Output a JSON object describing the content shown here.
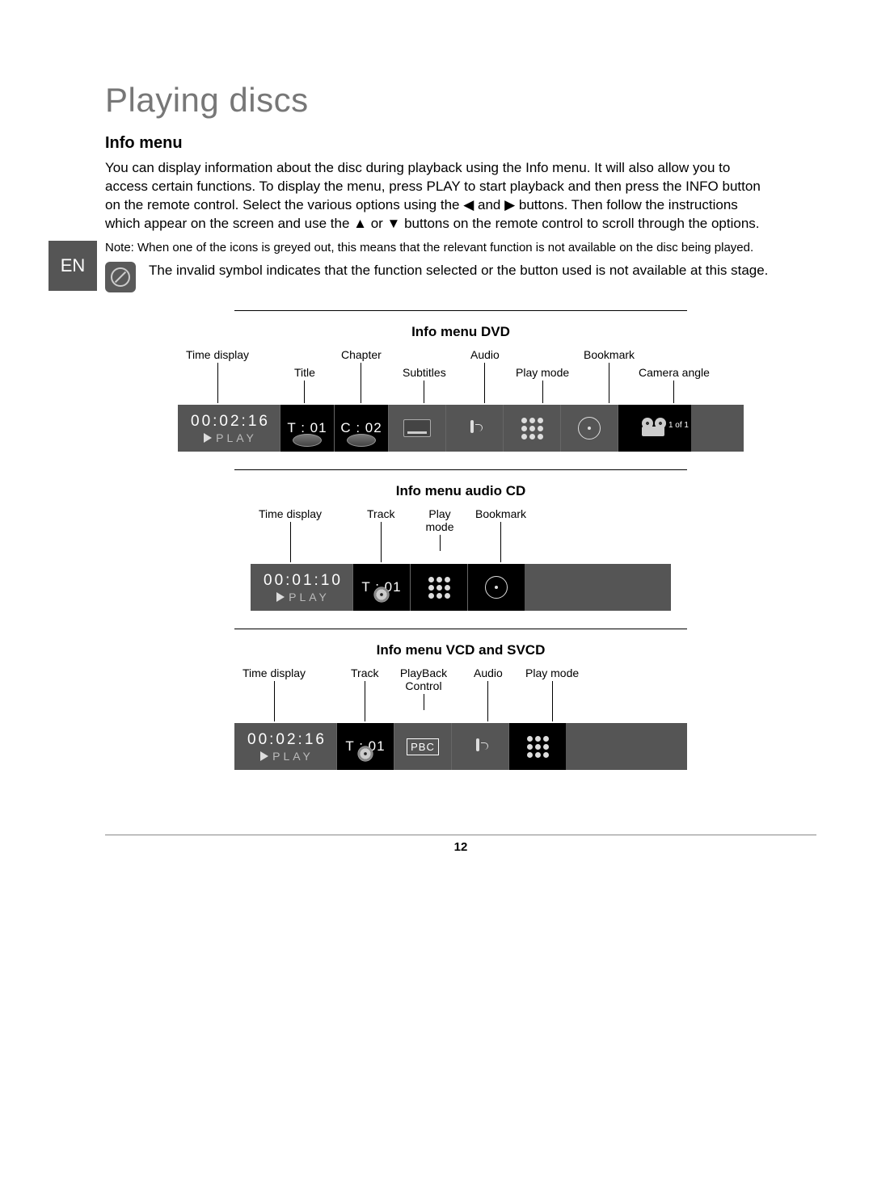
{
  "lang_tab": "EN",
  "page_title": "Playing discs",
  "section_heading": "Info menu",
  "paragraph": "You can display information about the disc during playback using the Info menu. It will also allow you to access certain functions. To display the menu, press PLAY to start playback and then press the INFO button on the remote control. Select the various options using the ◀ and ▶ buttons. Then follow the instructions which appear on the screen and use the ▲ or ▼ buttons on the remote control to scroll through the options.",
  "note": "Note: When one of the icons is greyed out, this means that the relevant function is not available on the disc being played.",
  "invalid_note": "The invalid symbol indicates that the function selected or the button used is not available at this stage.",
  "page_number": "12",
  "dvd": {
    "title": "Info menu DVD",
    "labels": {
      "time_display": "Time display",
      "title": "Title",
      "chapter": "Chapter",
      "subtitles": "Subtitles",
      "audio": "Audio",
      "play_mode": "Play mode",
      "bookmark": "Bookmark",
      "camera_angle": "Camera angle"
    },
    "bar": {
      "time": "00:02:16",
      "play": "PLAY",
      "title_val": "T : 01",
      "chapter_val": "C : 02",
      "angle_text": "1 of 1"
    }
  },
  "cd": {
    "title": "Info menu audio CD",
    "labels": {
      "time_display": "Time display",
      "track": "Track",
      "play_mode": "Play mode",
      "bookmark": "Bookmark"
    },
    "bar": {
      "time": "00:01:10",
      "play": "PLAY",
      "track_val": "T : 01"
    }
  },
  "vcd": {
    "title": "Info menu VCD and SVCD",
    "labels": {
      "time_display": "Time display",
      "track": "Track",
      "pbc": "PlayBack Control",
      "audio": "Audio",
      "play_mode": "Play mode"
    },
    "bar": {
      "time": "00:02:16",
      "play": "PLAY",
      "track_val": "T : 01",
      "pbc_text": "PBC"
    }
  }
}
